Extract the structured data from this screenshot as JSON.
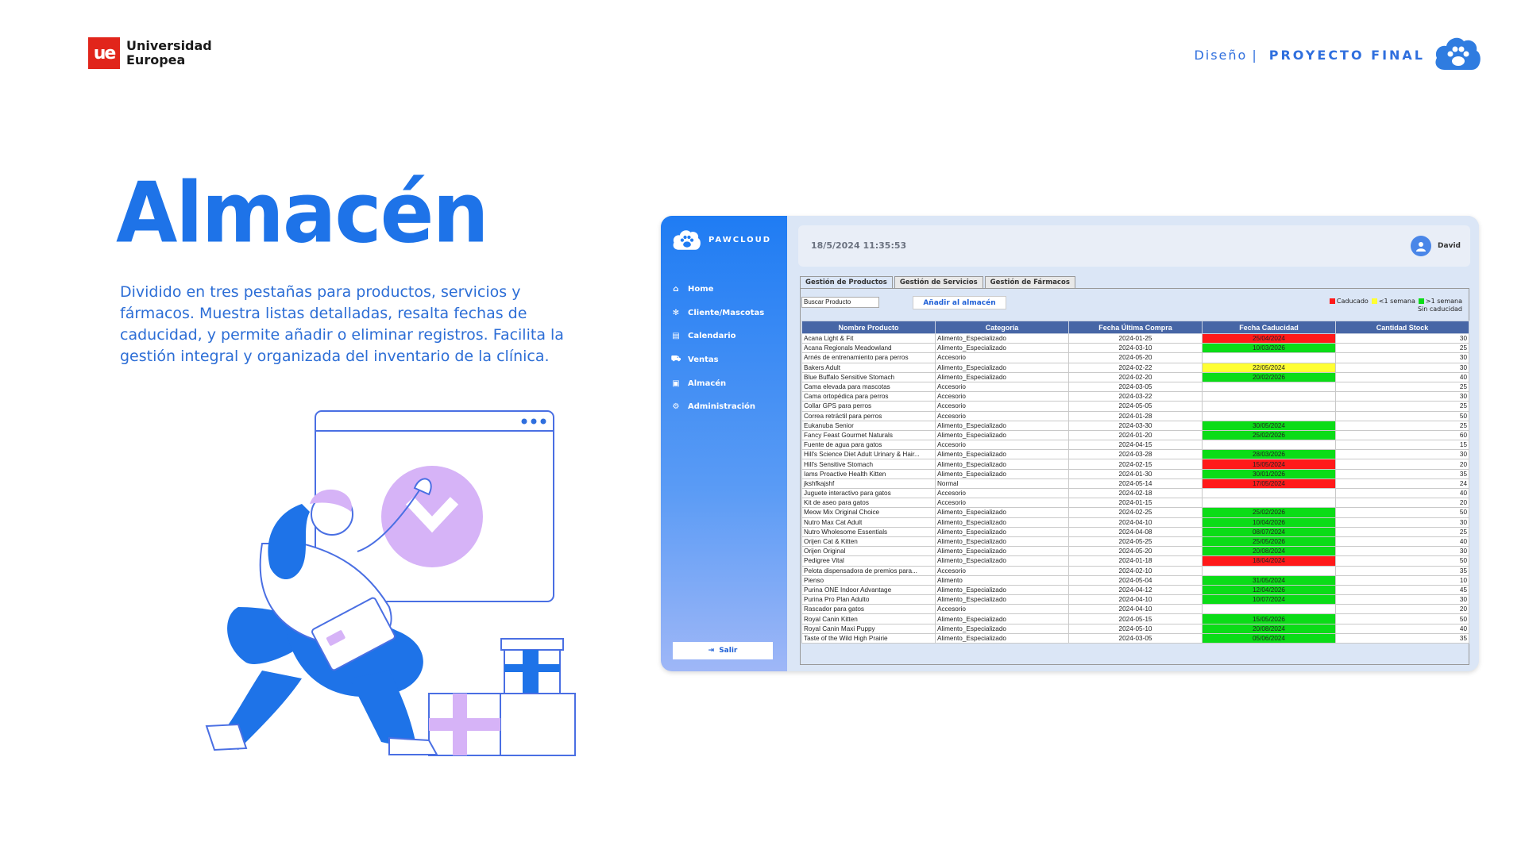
{
  "slide": {
    "brand_line1": "Universidad",
    "brand_line2": "Europea",
    "section": "Diseño",
    "separator": "|",
    "project": "PROYECTO FINAL",
    "title": "Almacén",
    "description": "Dividido en tres pestañas para productos, servicios y fármacos. Muestra listas detalladas, resalta fechas de caducidad, y permite añadir o eliminar registros. Facilita la gestión integral y organizada del inventario de la clínica.",
    "accent_color": "#1e73e8"
  },
  "app": {
    "brand": "PAWCLOUD",
    "datetime": "18/5/2024 11:35:53",
    "user": "David",
    "menu": [
      {
        "label": "Home",
        "icon": "home-icon"
      },
      {
        "label": "Cliente/Mascotas",
        "icon": "paw-icon"
      },
      {
        "label": "Calendario",
        "icon": "calendar-icon"
      },
      {
        "label": "Ventas",
        "icon": "cart-icon"
      },
      {
        "label": "Almacén",
        "icon": "warehouse-icon"
      },
      {
        "label": "Administración",
        "icon": "gear-icon"
      }
    ],
    "exit_label": "Salir",
    "tabs": [
      "Gestión de Productos",
      "Gestión de Servicios",
      "Gestión de Fármacos"
    ],
    "search_value": "Buscar Producto",
    "add_button": "Añadir al almacén",
    "legend": {
      "expired": "Caducado",
      "week": "<1 semana",
      "more": ">1 semana",
      "none": "Sin caducidad",
      "colors": {
        "expired": "#ff1a1a",
        "week": "#ffff33",
        "more": "#0bdc17"
      }
    },
    "columns": [
      "Nombre Producto",
      "Categoría",
      "Fecha Última Compra",
      "Fecha Caducidad",
      "Cantidad Stock"
    ],
    "rows": [
      {
        "name": "Acana Light & Fit",
        "category": "Alimento_Especializado",
        "last_purchase": "2024-01-25",
        "expiry": "25/04/2024",
        "status": "exp",
        "stock": "30"
      },
      {
        "name": "Acana Regionals Meadowland",
        "category": "Alimento_Especializado",
        "last_purchase": "2024-03-10",
        "expiry": "10/03/2026",
        "status": "ok",
        "stock": "25"
      },
      {
        "name": "Arnés de entrenamiento para perros",
        "category": "Accesorio",
        "last_purchase": "2024-05-20",
        "expiry": "",
        "status": "none",
        "stock": "30"
      },
      {
        "name": "Bakers Adult",
        "category": "Alimento_Especializado",
        "last_purchase": "2024-02-22",
        "expiry": "22/05/2024",
        "status": "week",
        "stock": "30"
      },
      {
        "name": "Blue Buffalo Sensitive Stomach",
        "category": "Alimento_Especializado",
        "last_purchase": "2024-02-20",
        "expiry": "20/02/2026",
        "status": "ok",
        "stock": "40"
      },
      {
        "name": "Cama elevada para mascotas",
        "category": "Accesorio",
        "last_purchase": "2024-03-05",
        "expiry": "",
        "status": "none",
        "stock": "25"
      },
      {
        "name": "Cama ortopédica para perros",
        "category": "Accesorio",
        "last_purchase": "2024-03-22",
        "expiry": "",
        "status": "none",
        "stock": "30"
      },
      {
        "name": "Collar GPS para perros",
        "category": "Accesorio",
        "last_purchase": "2024-05-05",
        "expiry": "",
        "status": "none",
        "stock": "25"
      },
      {
        "name": "Correa retráctil para perros",
        "category": "Accesorio",
        "last_purchase": "2024-01-28",
        "expiry": "",
        "status": "none",
        "stock": "50"
      },
      {
        "name": "Eukanuba Senior",
        "category": "Alimento_Especializado",
        "last_purchase": "2024-03-30",
        "expiry": "30/05/2024",
        "status": "ok",
        "stock": "25"
      },
      {
        "name": "Fancy Feast Gourmet Naturals",
        "category": "Alimento_Especializado",
        "last_purchase": "2024-01-20",
        "expiry": "25/02/2026",
        "status": "ok",
        "stock": "60"
      },
      {
        "name": "Fuente de agua para gatos",
        "category": "Accesorio",
        "last_purchase": "2024-04-15",
        "expiry": "",
        "status": "none",
        "stock": "15"
      },
      {
        "name": "Hill's Science Diet Adult Urinary & Hair...",
        "category": "Alimento_Especializado",
        "last_purchase": "2024-03-28",
        "expiry": "28/03/2026",
        "status": "ok",
        "stock": "30"
      },
      {
        "name": "Hill's Sensitive Stomach",
        "category": "Alimento_Especializado",
        "last_purchase": "2024-02-15",
        "expiry": "15/05/2024",
        "status": "exp",
        "stock": "20"
      },
      {
        "name": "Iams Proactive Health Kitten",
        "category": "Alimento_Especializado",
        "last_purchase": "2024-01-30",
        "expiry": "30/01/2026",
        "status": "ok",
        "stock": "35"
      },
      {
        "name": "jkshfkajshf",
        "category": "Normal",
        "last_purchase": "2024-05-14",
        "expiry": "17/05/2024",
        "status": "exp",
        "stock": "24"
      },
      {
        "name": "Juguete interactivo para gatos",
        "category": "Accesorio",
        "last_purchase": "2024-02-18",
        "expiry": "",
        "status": "none",
        "stock": "40"
      },
      {
        "name": "Kit de aseo para gatos",
        "category": "Accesorio",
        "last_purchase": "2024-01-15",
        "expiry": "",
        "status": "none",
        "stock": "20"
      },
      {
        "name": "Meow Mix Original Choice",
        "category": "Alimento_Especializado",
        "last_purchase": "2024-02-25",
        "expiry": "25/02/2026",
        "status": "ok",
        "stock": "50"
      },
      {
        "name": "Nutro Max Cat Adult",
        "category": "Alimento_Especializado",
        "last_purchase": "2024-04-10",
        "expiry": "10/04/2026",
        "status": "ok",
        "stock": "30"
      },
      {
        "name": "Nutro Wholesome Essentials",
        "category": "Alimento_Especializado",
        "last_purchase": "2024-04-08",
        "expiry": "08/07/2024",
        "status": "ok",
        "stock": "25"
      },
      {
        "name": "Orijen Cat & Kitten",
        "category": "Alimento_Especializado",
        "last_purchase": "2024-05-25",
        "expiry": "25/05/2026",
        "status": "ok",
        "stock": "40"
      },
      {
        "name": "Orijen Original",
        "category": "Alimento_Especializado",
        "last_purchase": "2024-05-20",
        "expiry": "20/08/2024",
        "status": "ok",
        "stock": "30"
      },
      {
        "name": "Pedigree Vital",
        "category": "Alimento_Especializado",
        "last_purchase": "2024-01-18",
        "expiry": "18/04/2024",
        "status": "exp",
        "stock": "50"
      },
      {
        "name": "Pelota dispensadora de premios para...",
        "category": "Accesorio",
        "last_purchase": "2024-02-10",
        "expiry": "",
        "status": "none",
        "stock": "35"
      },
      {
        "name": "Pienso",
        "category": "Alimento",
        "last_purchase": "2024-05-04",
        "expiry": "31/05/2024",
        "status": "ok",
        "stock": "10"
      },
      {
        "name": "Purina ONE Indoor Advantage",
        "category": "Alimento_Especializado",
        "last_purchase": "2024-04-12",
        "expiry": "12/04/2026",
        "status": "ok",
        "stock": "45"
      },
      {
        "name": "Purina Pro Plan Adulto",
        "category": "Alimento_Especializado",
        "last_purchase": "2024-04-10",
        "expiry": "10/07/2024",
        "status": "ok",
        "stock": "30"
      },
      {
        "name": "Rascador para gatos",
        "category": "Accesorio",
        "last_purchase": "2024-04-10",
        "expiry": "",
        "status": "none",
        "stock": "20"
      },
      {
        "name": "Royal Canin Kitten",
        "category": "Alimento_Especializado",
        "last_purchase": "2024-05-15",
        "expiry": "15/05/2026",
        "status": "ok",
        "stock": "50"
      },
      {
        "name": "Royal Canin Maxi Puppy",
        "category": "Alimento_Especializado",
        "last_purchase": "2024-05-10",
        "expiry": "20/08/2024",
        "status": "ok",
        "stock": "40"
      },
      {
        "name": "Taste of the Wild High Prairie",
        "category": "Alimento_Especializado",
        "last_purchase": "2024-03-05",
        "expiry": "05/06/2024",
        "status": "ok",
        "stock": "35"
      }
    ]
  }
}
